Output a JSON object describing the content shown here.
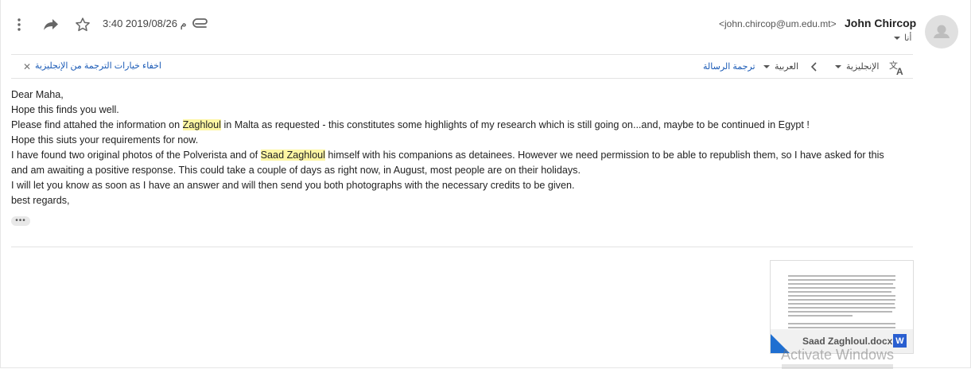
{
  "header": {
    "date": "3:40 2019/08/26 م",
    "sender_name": "John Chircop",
    "sender_email": "<john.chircop@um.edu.mt>",
    "to_label": "أنا"
  },
  "translation_bar": {
    "hide_label": "اخفاء خيارات الترجمة من الإنجليزية",
    "translate_label": "ترجمة الرسالة",
    "target_language": "العربية",
    "source_language": "الإنجليزية"
  },
  "message": {
    "greeting": "Dear Maha,",
    "line1": "Hope this finds you well.",
    "line2": {
      "before": "Please find attahed the information on ",
      "highlight": "Zaghloul",
      "after": " in Malta as requested - this constitutes some highlights of my research which is still going on...and, maybe to be continued in Egypt !"
    },
    "line3": "Hope this siuts your requirements for now.",
    "line4": {
      "before": "I have found two original photos of the Polverista and of ",
      "highlight": "Saad Zaghloul",
      "after": " himself with his companions as detainees. However we need permission to be able to republish them, so I have asked for this"
    },
    "line5": "and am awaiting a positive response. This could take a couple of days as right now, in August, most people are on their holidays.",
    "line6": "I will let you know as soon as I have an answer and will then send you both photographs with the necessary credits to be given.",
    "closing": "best regards,",
    "trimmed_label": "•••"
  },
  "attachment": {
    "filename": "Saad Zaghloul.docx",
    "type_badge": "W"
  },
  "overlay": {
    "watermark": "Activate Windows"
  },
  "icons": {
    "more": "more-vert-icon",
    "forward": "forward-icon",
    "star": "star-icon",
    "attachment": "paperclip-icon",
    "avatar": "person-avatar-icon",
    "translate": "translate-icon",
    "close": "close-icon"
  },
  "colors": {
    "highlight": "#fdf6a3",
    "link": "#1a5ab6",
    "word_blue": "#2a5fd0"
  }
}
